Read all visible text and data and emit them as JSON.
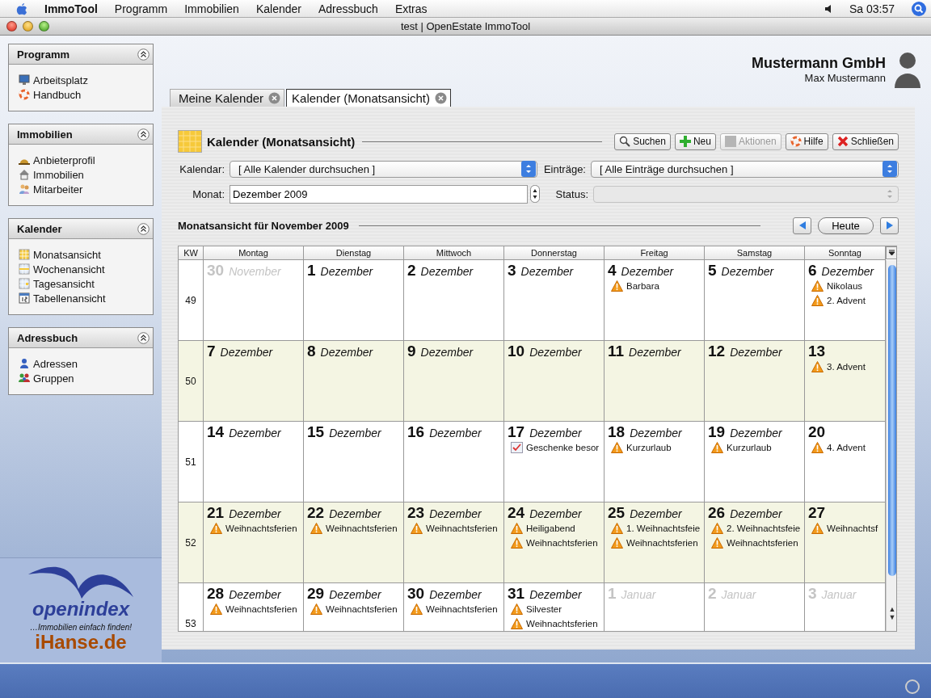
{
  "menubar": {
    "app": "ImmoTool",
    "items": [
      "Programm",
      "Immobilien",
      "Kalender",
      "Adressbuch",
      "Extras"
    ],
    "clock": "Sa 03:57"
  },
  "window": {
    "title": "test | OpenEstate ImmoTool"
  },
  "sidebar": {
    "panels": [
      {
        "title": "Programm",
        "items": [
          "Arbeitsplatz",
          "Handbuch"
        ]
      },
      {
        "title": "Immobilien",
        "items": [
          "Anbieterprofil",
          "Immobilien",
          "Mitarbeiter"
        ]
      },
      {
        "title": "Kalender",
        "items": [
          "Monatsansicht",
          "Wochenansicht",
          "Tagesansicht",
          "Tabellenansicht"
        ]
      },
      {
        "title": "Adressbuch",
        "items": [
          "Adressen",
          "Gruppen"
        ]
      }
    ],
    "logo": {
      "brand": "openindex",
      "slogan": "…Immobilien einfach finden!",
      "site": "iHanse.de"
    }
  },
  "header": {
    "company": "Mustermann GmbH",
    "user": "Max Mustermann"
  },
  "tabs": [
    {
      "label": "Meine Kalender",
      "selected": false
    },
    {
      "label": "Kalender (Monatsansicht)",
      "selected": true
    }
  ],
  "view": {
    "title": "Kalender (Monatsansicht)",
    "buttons": [
      {
        "label": "Suchen",
        "disabled": false
      },
      {
        "label": "Neu",
        "disabled": false
      },
      {
        "label": "Aktionen",
        "disabled": true
      },
      {
        "label": "Hilfe",
        "disabled": false
      },
      {
        "label": "Schließen",
        "disabled": false
      }
    ],
    "filters": [
      {
        "label": "Kalendar:",
        "value": "[ Alle Kalender durchsuchen ]",
        "disabled": false
      },
      {
        "label": "Einträge:",
        "value": "[ Alle Einträge durchsuchen ]",
        "disabled": false
      }
    ],
    "month": {
      "label": "Monat:",
      "value": "Dezember 2009"
    },
    "status": {
      "label": "Status:",
      "disabled": true
    }
  },
  "calendar": {
    "title": "Monatsansicht für November 2009",
    "today": "Heute",
    "columns": [
      "KW",
      "Montag",
      "Dienstag",
      "Mittwoch",
      "Donnerstag",
      "Freitag",
      "Samstag",
      "Sonntag"
    ],
    "scroll_arrows": [
      "▲",
      "▼"
    ],
    "weeks": [
      {
        "kw": "49",
        "shaded": false,
        "days": [
          {
            "num": "30",
            "month": "November",
            "other": true
          },
          {
            "num": "1",
            "month": "Dezember",
            "other": false
          },
          {
            "num": "2",
            "month": "Dezember",
            "other": false
          },
          {
            "num": "3",
            "month": "Dezember",
            "other": false
          },
          {
            "num": "4",
            "month": "Dezember",
            "other": false,
            "entries": [
              {
                "kind": "warning",
                "text": "Barbara"
              }
            ]
          },
          {
            "num": "5",
            "month": "Dezember",
            "other": false
          },
          {
            "num": "6",
            "month": "Dezember",
            "other": false,
            "entries": [
              {
                "kind": "warning",
                "text": "Nikolaus"
              },
              {
                "kind": "warning",
                "text": "2. Advent"
              }
            ]
          }
        ]
      },
      {
        "kw": "50",
        "shaded": true,
        "days": [
          {
            "num": "7",
            "month": "Dezember",
            "other": false
          },
          {
            "num": "8",
            "month": "Dezember",
            "other": false
          },
          {
            "num": "9",
            "month": "Dezember",
            "other": false
          },
          {
            "num": "10",
            "month": "Dezember",
            "other": false
          },
          {
            "num": "11",
            "month": "Dezember",
            "other": false
          },
          {
            "num": "12",
            "month": "Dezember",
            "other": false
          },
          {
            "num": "13",
            "other": false,
            "entries": [
              {
                "kind": "warning",
                "text": "3. Advent"
              }
            ]
          }
        ]
      },
      {
        "kw": "51",
        "shaded": false,
        "days": [
          {
            "num": "14",
            "month": "Dezember",
            "other": false
          },
          {
            "num": "15",
            "month": "Dezember",
            "other": false
          },
          {
            "num": "16",
            "month": "Dezember",
            "other": false
          },
          {
            "num": "17",
            "month": "Dezember",
            "other": false,
            "entries": [
              {
                "kind": "task",
                "text": "Geschenke besor"
              }
            ]
          },
          {
            "num": "18",
            "month": "Dezember",
            "other": false,
            "entries": [
              {
                "kind": "warning",
                "text": "Kurzurlaub"
              }
            ]
          },
          {
            "num": "19",
            "month": "Dezember",
            "other": false,
            "entries": [
              {
                "kind": "warning",
                "text": "Kurzurlaub"
              }
            ]
          },
          {
            "num": "20",
            "other": false,
            "entries": [
              {
                "kind": "warning",
                "text": "4. Advent"
              }
            ]
          }
        ]
      },
      {
        "kw": "52",
        "shaded": true,
        "days": [
          {
            "num": "21",
            "month": "Dezember",
            "other": false,
            "entries": [
              {
                "kind": "warning",
                "text": "Weihnachtsferien"
              }
            ]
          },
          {
            "num": "22",
            "month": "Dezember",
            "other": false,
            "entries": [
              {
                "kind": "warning",
                "text": "Weihnachtsferien"
              }
            ]
          },
          {
            "num": "23",
            "month": "Dezember",
            "other": false,
            "entries": [
              {
                "kind": "warning",
                "text": "Weihnachtsferien"
              }
            ]
          },
          {
            "num": "24",
            "month": "Dezember",
            "other": false,
            "entries": [
              {
                "kind": "warning",
                "text": "Heiligabend"
              },
              {
                "kind": "warning",
                "text": "Weihnachtsferien"
              }
            ]
          },
          {
            "num": "25",
            "month": "Dezember",
            "other": false,
            "entries": [
              {
                "kind": "warning",
                "text": "1. Weihnachtsfeie"
              },
              {
                "kind": "warning",
                "text": "Weihnachtsferien"
              }
            ]
          },
          {
            "num": "26",
            "month": "Dezember",
            "other": false,
            "entries": [
              {
                "kind": "warning",
                "text": "2. Weihnachtsfeie"
              },
              {
                "kind": "warning",
                "text": "Weihnachtsferien"
              }
            ]
          },
          {
            "num": "27",
            "other": false,
            "entries": [
              {
                "kind": "warning",
                "text": "Weihnachtsf"
              }
            ]
          }
        ]
      },
      {
        "kw": "53",
        "shaded": false,
        "days": [
          {
            "num": "28",
            "month": "Dezember",
            "other": false,
            "entries": [
              {
                "kind": "warning",
                "text": "Weihnachtsferien"
              }
            ]
          },
          {
            "num": "29",
            "month": "Dezember",
            "other": false,
            "entries": [
              {
                "kind": "warning",
                "text": "Weihnachtsferien"
              }
            ]
          },
          {
            "num": "30",
            "month": "Dezember",
            "other": false,
            "entries": [
              {
                "kind": "warning",
                "text": "Weihnachtsferien"
              }
            ]
          },
          {
            "num": "31",
            "month": "Dezember",
            "other": false,
            "entries": [
              {
                "kind": "warning",
                "text": "Silvester"
              },
              {
                "kind": "warning",
                "text": "Weihnachtsferien"
              }
            ]
          },
          {
            "num": "1",
            "month": "Januar",
            "other": true
          },
          {
            "num": "2",
            "month": "Januar",
            "other": true
          },
          {
            "num": "3",
            "month": "Januar",
            "other": true
          }
        ]
      }
    ]
  }
}
